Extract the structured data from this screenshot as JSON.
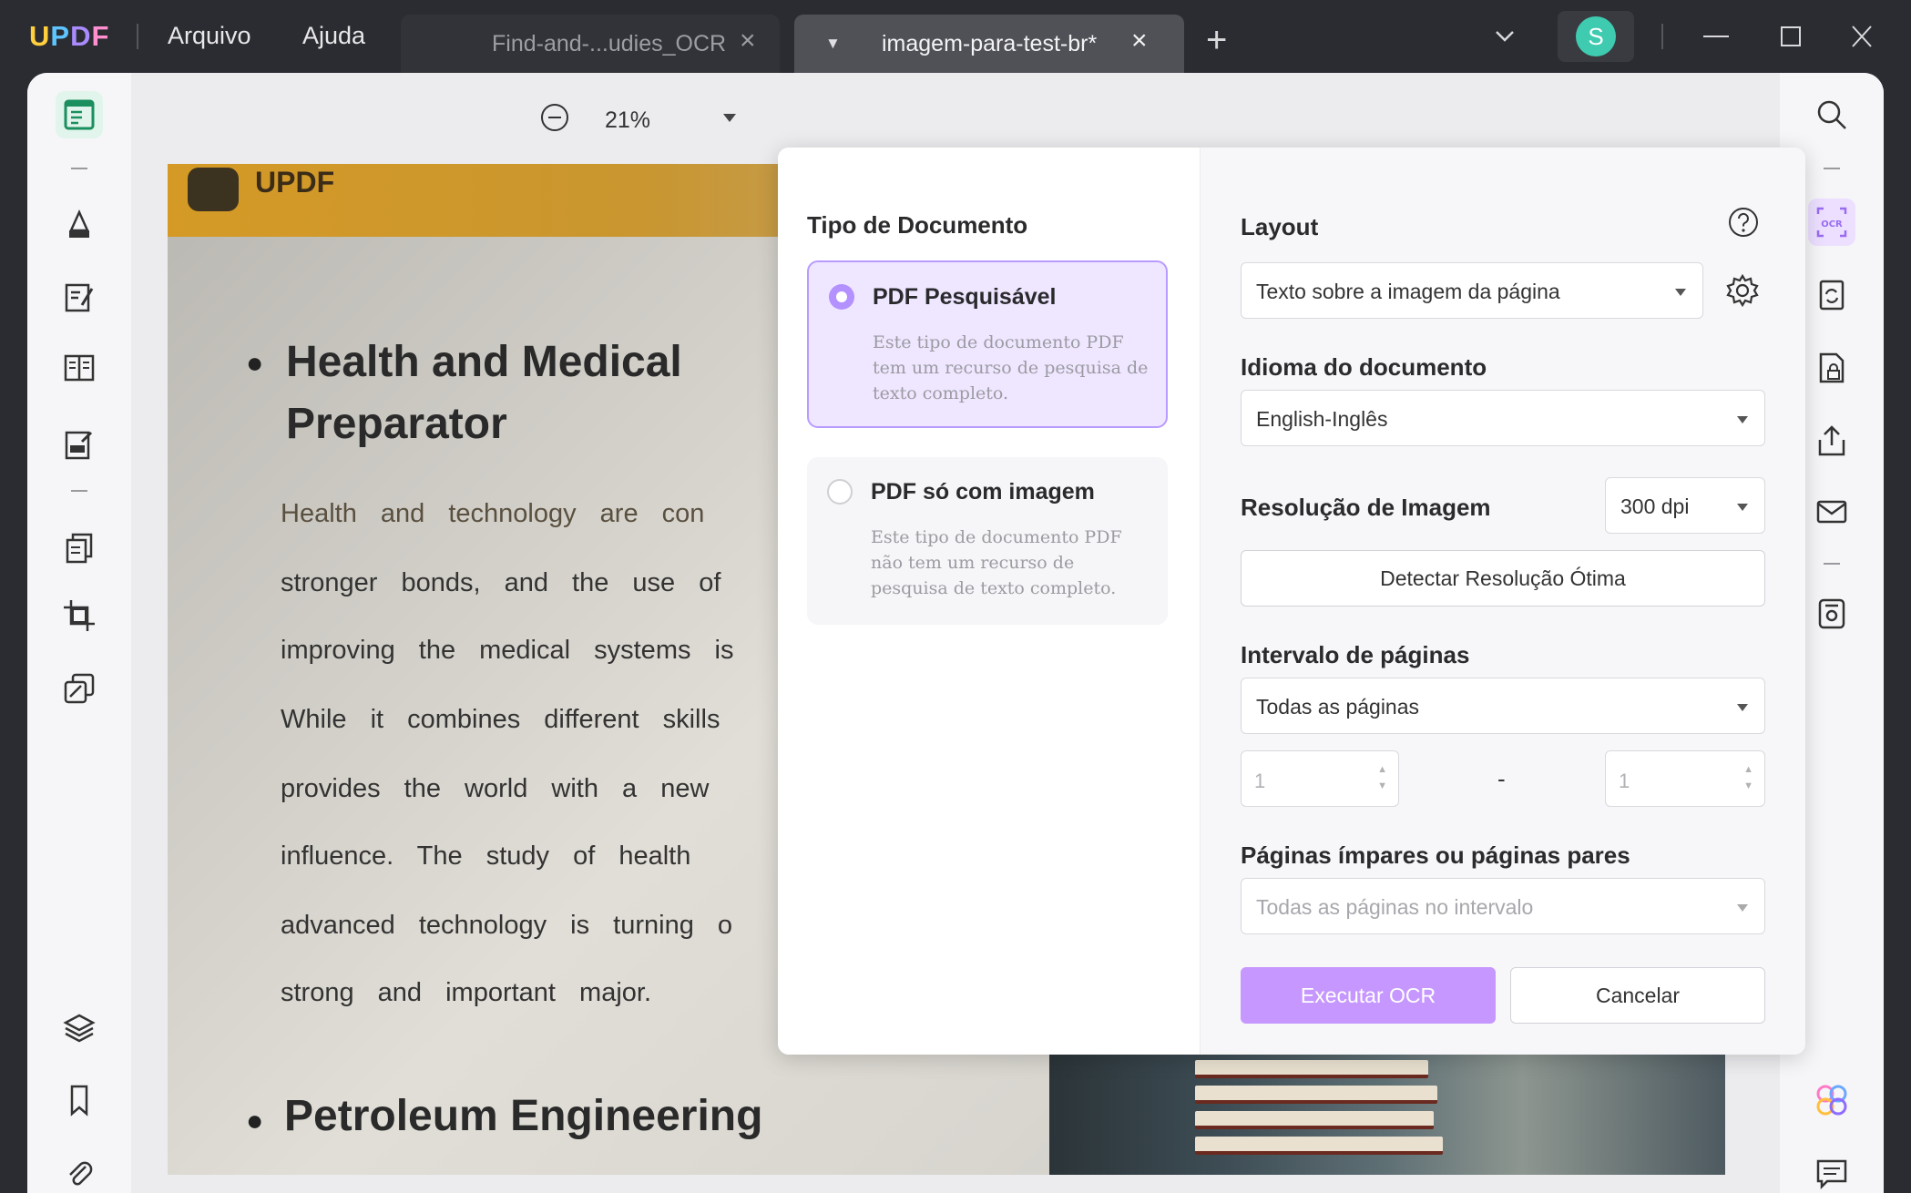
{
  "app": {
    "logo": "UPDF",
    "menu": [
      "Arquivo",
      "Ajuda"
    ],
    "user_initial": "S"
  },
  "tabs": [
    {
      "title": "Find-and-...udies_OCR",
      "active": false
    },
    {
      "title": "imagem-para-test-br*",
      "active": true
    }
  ],
  "toolbar": {
    "zoom": "21%"
  },
  "document": {
    "banner_brand": "UPDF",
    "heading1_line1": "Health and Medical",
    "heading1_line2": "Preparator",
    "lines": [
      "Health and technology are con",
      "stronger bonds, and the use of",
      "improving the medical systems is",
      "While it combines different skills",
      "provides the world with a new",
      "influence. The study of health",
      "advanced technology is turning o",
      "strong and important major."
    ],
    "heading2": "Petroleum Engineering"
  },
  "ocr": {
    "doc_type_title": "Tipo de Documento",
    "options": [
      {
        "title": "PDF Pesquisável",
        "desc": "Este tipo de documento PDF tem um recurso de pesquisa de texto completo.",
        "selected": true
      },
      {
        "title": "PDF só com imagem",
        "desc": "Este tipo de documento PDF não tem um recurso de pesquisa de texto completo.",
        "selected": false
      }
    ],
    "layout_label": "Layout",
    "layout_value": "Texto sobre a imagem da página",
    "language_label": "Idioma do documento",
    "language_value": "English-Inglês",
    "resolution_label": "Resolução de Imagem",
    "resolution_value": "300 dpi",
    "detect_button": "Detectar Resolução Ótima",
    "range_label": "Intervalo de páginas",
    "range_value": "Todas as páginas",
    "range_from": "1",
    "range_dash": "-",
    "range_to": "1",
    "parity_label": "Páginas ímpares ou páginas pares",
    "parity_value": "Todas as páginas no intervalo",
    "run_button": "Executar OCR",
    "cancel_button": "Cancelar"
  },
  "colors": {
    "accent": "#c697ff",
    "selected_bg": "#efe6ff",
    "avatar": "#3ecbb0"
  },
  "icons": {
    "left_tools": [
      "reader-icon",
      "highlighter-icon",
      "edit-pdf-icon",
      "organize-pages-icon",
      "fill-sign-icon",
      "convert-icon",
      "crop-icon",
      "protect-icon",
      "layers-icon",
      "bookmark-icon",
      "attachment-icon"
    ],
    "right_tools": [
      "search-icon",
      "ocr-icon",
      "convert-pdf-icon",
      "protect-file-icon",
      "share-icon",
      "email-icon",
      "save-icon",
      "ai-assistant-icon",
      "comment-icon"
    ]
  }
}
